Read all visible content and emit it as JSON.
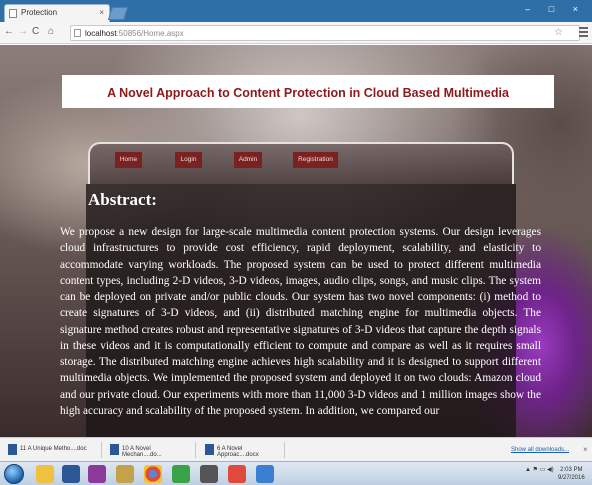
{
  "browser": {
    "tab_title": "Protection",
    "tab_close": "×",
    "window_controls": "– □ ×",
    "url_host": "localhost",
    "url_path": ":50856/Home.aspx"
  },
  "page": {
    "header_title": "A Novel Approach to Content Protection in Cloud Based Multimedia",
    "nav": [
      "Home",
      "Login",
      "Admin",
      "Registration"
    ],
    "abstract_heading": "Abstract:",
    "abstract_text": "We propose a new design for large-scale multimedia content protection systems. Our design leverages cloud infrastructures to provide cost efficiency, rapid deployment, scalability, and elasticity to accommodate varying workloads. The proposed system can be used to protect different multimedia content types, including 2-D videos, 3-D videos, images, audio clips, songs, and music clips. The system can be deployed on private and/or public clouds. Our system has two novel components: (i) method to create signatures of 3-D videos, and (ii) distributed matching engine for multimedia objects. The signature method creates robust and representative signatures of 3-D videos that capture the depth signals in these videos and it is computationally efficient to compute and compare as well as it requires small storage. The distributed matching engine achieves high scalability and it is designed to support different multimedia objects. We implemented the proposed system and deployed it on two clouds: Amazon cloud and our private cloud. Our experiments with more than 11,000 3-D videos and 1 million images show the high accuracy and scalability of the proposed system. In addition, we compared our"
  },
  "downloads": {
    "items": [
      "11 A Unique Metho....doc",
      "10 A Novel Mechan....do...",
      "6 A Novel Approac....docx"
    ],
    "show_all": "Show all downloads...",
    "close": "×"
  },
  "taskbar": {
    "time": "2:03 PM",
    "date": "9/27/2016"
  },
  "colors": {
    "title_red": "#8b1a1a",
    "nav_button": "#7a2222",
    "chrome_blue": "#2f6fa8"
  }
}
